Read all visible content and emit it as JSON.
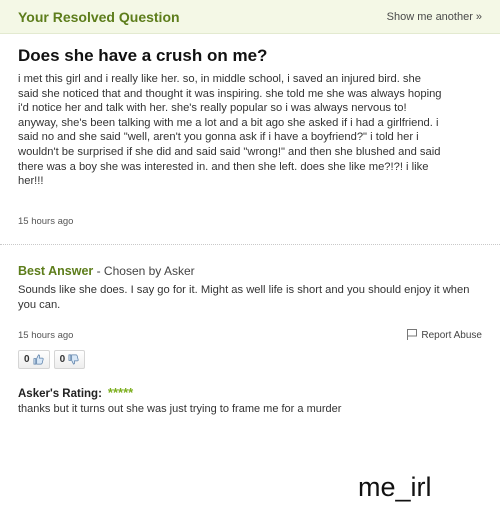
{
  "header": {
    "title": "Your Resolved Question",
    "show_another": "Show me another",
    "show_another_icon": "raquo-icon"
  },
  "question": {
    "title": "Does she have a crush on me?",
    "body": "i met this girl and i really like her. so, in middle school, i saved an injured bird. she\nsaid she noticed that and thought it was inspiring. she told me she was always hoping\ni'd notice her and talk with her. she's really popular so i was always nervous to!\nanyway, she's been talking with me a lot and a bit ago she asked if i had a girlfriend. i\nsaid no and she said \"well, aren't you gonna ask if i have a boyfriend?\" i told her i\nwouldn't be surprised if she did and said said \"wrong!\" and then she blushed and said\nthere was a boy she was interested in. and then she left. does she like me?!?! i like\nher!!!",
    "time": "15 hours ago"
  },
  "best_answer": {
    "label": "Best Answer",
    "chosen_by": " - Chosen by Asker",
    "body": "Sounds like she does. I say go for it. Might as well life is short and you should enjoy it when you can.",
    "time": "15 hours ago",
    "report_label": "Report Abuse"
  },
  "votes": {
    "up_count": "0",
    "down_count": "0"
  },
  "rating": {
    "label": "Asker's Rating:",
    "stars": "*****",
    "star_value": 5,
    "comment": "thanks but it turns out she was just trying to frame me for a murder"
  },
  "caption": "me_irl",
  "colors": {
    "brand_green": "#5d7d1b",
    "star_green": "#7cae1e",
    "header_bg": "#f4f8e6"
  }
}
